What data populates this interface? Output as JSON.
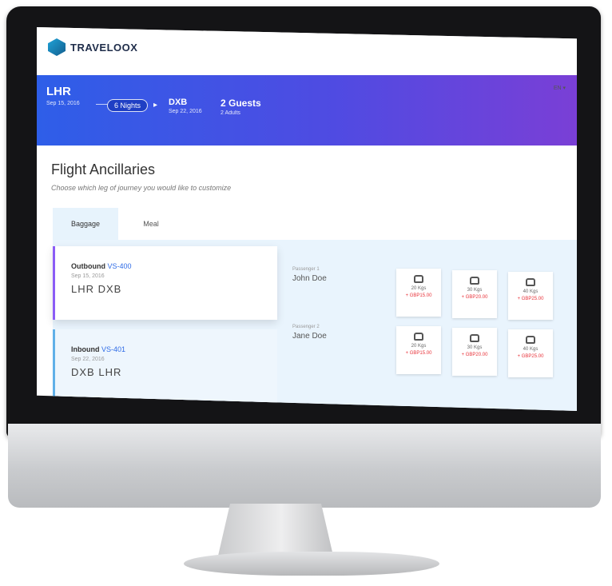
{
  "app": {
    "brand": "TRAVELOOX"
  },
  "hero": {
    "origin_code": "LHR",
    "origin_date": "Sep 15, 2016",
    "nights": "6 Nights",
    "dest_code": "DXB",
    "dest_date": "Sep 22, 2016",
    "guests": "2 Guests",
    "adults": "2 Adults",
    "lang": "EN ▾"
  },
  "page": {
    "title": "Flight Ancillaries",
    "subtitle": "Choose which leg of journey you would like to customize"
  },
  "tabs": [
    {
      "label": "Baggage",
      "active": true
    },
    {
      "label": "Meal",
      "active": false
    }
  ],
  "legs": [
    {
      "direction": "Outbound",
      "flight": "VS-400",
      "date": "Sep 15, 2016",
      "route": "LHR  DXB"
    },
    {
      "direction": "Inbound",
      "flight": "VS-401",
      "date": "Sep 22, 2016",
      "route": "DXB  LHR"
    }
  ],
  "passengers": [
    {
      "label": "Passenger 1",
      "name": "John Doe",
      "options": [
        {
          "weight": "20 Kgs",
          "price": "+ GBP15.00"
        },
        {
          "weight": "30 Kgs",
          "price": "+ GBP20.00"
        },
        {
          "weight": "40 Kgs",
          "price": "+ GBP25.00"
        }
      ]
    },
    {
      "label": "Passenger 2",
      "name": "Jane Doe",
      "options": [
        {
          "weight": "20 Kgs",
          "price": "+ GBP15.00"
        },
        {
          "weight": "30 Kgs",
          "price": "+ GBP20.00"
        },
        {
          "weight": "40 Kgs",
          "price": "+ GBP25.00"
        }
      ]
    }
  ],
  "colors": {
    "accent": "#4f4be2",
    "price": "#e8333a",
    "leg_active": "#8b5cf6"
  }
}
